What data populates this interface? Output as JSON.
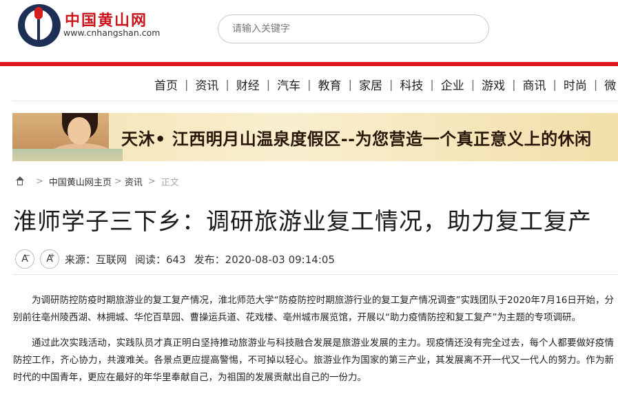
{
  "site": {
    "logo_name": "中国黄山网",
    "logo_url": "www.cnhangshan.com"
  },
  "search": {
    "placeholder": "请输入关键字"
  },
  "nav": {
    "items": [
      "首页",
      "资讯",
      "财经",
      "汽车",
      "教育",
      "家居",
      "科技",
      "企业",
      "游戏",
      "商讯",
      "时尚",
      "微"
    ]
  },
  "banner": {
    "text": "天沐• 江西明月山温泉度假区--为您营造一个真正意义上的休闲"
  },
  "breadcrumb": {
    "home_link": "中国黄山网主页",
    "section": "资讯",
    "current": "正文",
    "separator": ">"
  },
  "article": {
    "title": "淮师学子三下乡：调研旅游业复工情况，助力复工复产",
    "font_decrease": "A",
    "font_increase": "A",
    "source": "来源：互联网",
    "reads": "阅读：643",
    "published": "发布：2020-08-03 09:14:05",
    "paragraphs": [
      "为调研防控防疫时期旅游业的复工复产情况，淮北师范大学“防疫防控时期旅游行业的复工复产情况调查”实践团队于2020年7月16日开始，分别前往亳州陵西湖、林拥城、华佗百草园、曹操运兵道、花戏楼、亳州城市展览馆，开展以“助力疫情防控和复工复产”为主题的专项调研。",
      "通过此次实践活动，实践队员才真正明白坚持推动旅游业与科技融合发展是旅游业发展的主力。现疫情还没有完全过去，每个人都要做好疫情防控工作，齐心协力，共渡难关。各景点更应提高警惕，不可掉以轻心。旅游业作为国家的第三产业，其发展离不开一代又一代人的努力。作为新时代的中国青年，更应在最好的年华里奉献自己，为祖国的发展贡献出自己的一份力。"
    ]
  }
}
